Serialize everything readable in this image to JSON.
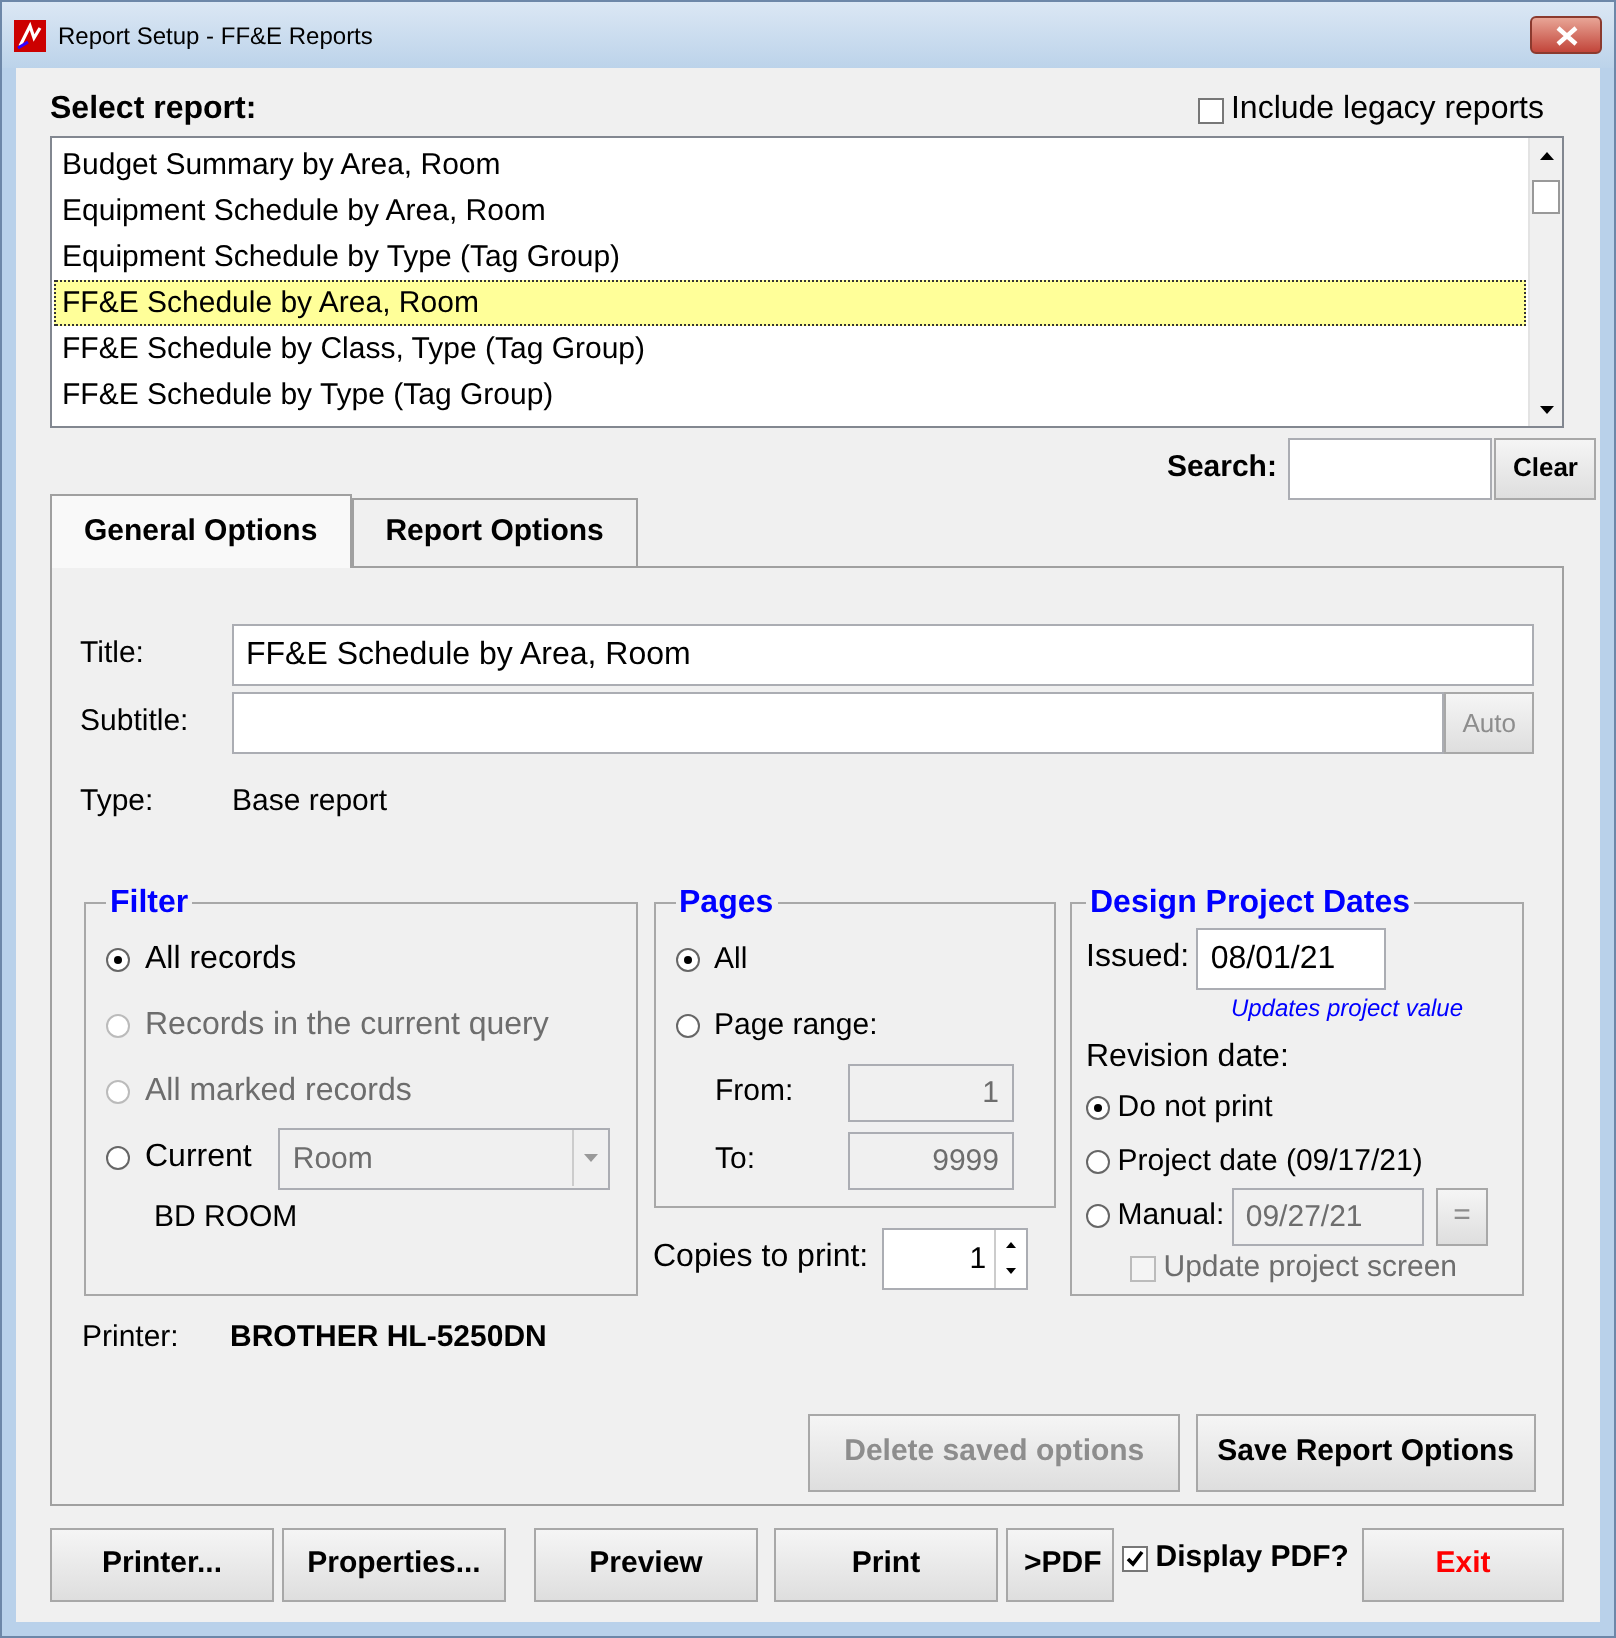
{
  "window": {
    "title": "Report Setup - FF&E Reports"
  },
  "select_label": "Select report:",
  "include_legacy": {
    "label": "Include legacy reports",
    "checked": false
  },
  "reports": [
    {
      "label": "Budget Summary by Area, Room",
      "selected": false
    },
    {
      "label": "Equipment Schedule by Area, Room",
      "selected": false
    },
    {
      "label": "Equipment Schedule by Type (Tag Group)",
      "selected": false
    },
    {
      "label": "FF&E Schedule by Area, Room",
      "selected": true
    },
    {
      "label": "FF&E Schedule by Class, Type (Tag Group)",
      "selected": false
    },
    {
      "label": "FF&E Schedule by Type (Tag Group)",
      "selected": false
    }
  ],
  "search": {
    "label": "Search:",
    "button": "Clear"
  },
  "tabs": [
    {
      "label": "General Options",
      "selected": true
    },
    {
      "label": "Report Options",
      "selected": false
    }
  ],
  "title_field": {
    "label": "Title:",
    "value": "FF&E Schedule by Area, Room"
  },
  "subtitle_field": {
    "label": "Subtitle:",
    "button": "Auto",
    "button_disabled": true
  },
  "type": {
    "label": "Type:",
    "value": "Base report"
  },
  "filter": {
    "legend": "Filter",
    "options": [
      {
        "label": "All records",
        "selected": true,
        "disabled": false
      },
      {
        "label": "Records in the current query",
        "selected": false,
        "disabled": true
      },
      {
        "label": "All marked records",
        "selected": false,
        "disabled": true
      },
      {
        "label": "Current",
        "selected": false,
        "disabled": false,
        "combo": {
          "value": "Room",
          "disabled": true
        }
      }
    ],
    "current_value": "BD ROOM"
  },
  "pages": {
    "legend": "Pages",
    "options": [
      {
        "label": "All",
        "selected": true
      },
      {
        "label": "Page range:",
        "selected": false
      }
    ],
    "from": {
      "label": "From:",
      "value": "1"
    },
    "to": {
      "label": "To:",
      "value": "9999"
    }
  },
  "copies": {
    "label": "Copies to print:",
    "value": "1"
  },
  "dates": {
    "legend": "Design Project Dates",
    "issued": {
      "label": "Issued:",
      "value": "08/01/21"
    },
    "note": "Updates project value",
    "revision_label": "Revision date:",
    "options": [
      {
        "label": "Do not print",
        "selected": true
      },
      {
        "label": "Project date (09/17/21)",
        "selected": false
      },
      {
        "label": "Manual:",
        "selected": false,
        "field": "09/27/21",
        "button": "="
      }
    ],
    "update_project": {
      "label": "Update project screen",
      "checked": false,
      "disabled": true
    }
  },
  "printer": {
    "label": "Printer:",
    "value": "BROTHER HL-5250DN"
  },
  "option_buttons": [
    {
      "label": "Delete saved options",
      "disabled": true
    },
    {
      "label": "Save Report Options",
      "disabled": false
    }
  ],
  "buttons": [
    {
      "kind": "button",
      "label": "Printer..."
    },
    {
      "kind": "button",
      "label": "Properties..."
    },
    {
      "kind": "button",
      "label": "Preview"
    },
    {
      "kind": "button",
      "label": "Print"
    },
    {
      "kind": "button",
      "label": ">PDF"
    },
    {
      "kind": "checkbox",
      "label": "Display PDF?",
      "checked": true
    },
    {
      "kind": "exit",
      "label": "Exit"
    }
  ]
}
